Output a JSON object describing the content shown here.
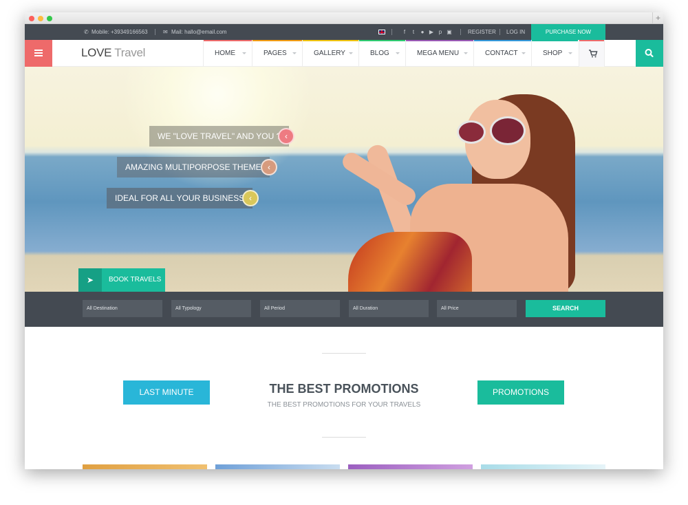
{
  "topbar": {
    "mobile": "Mobile: +39349166563",
    "mail": "Mail: hallo@email.com",
    "social_icons": [
      "facebook-icon",
      "twitter-icon",
      "flickr-icon",
      "youtube-icon",
      "pinterest-icon",
      "instagram-icon"
    ],
    "register": "REGISTER",
    "login": "LOG IN",
    "purchase": "PURCHASE NOW"
  },
  "header": {
    "logo_bold": "LOVE",
    "logo_light": "Travel",
    "nav": [
      {
        "label": "HOME",
        "color": "#ee6a6a"
      },
      {
        "label": "PAGES",
        "color": "#f39c12"
      },
      {
        "label": "GALLERY",
        "color": "#f1c40f"
      },
      {
        "label": "BLOG",
        "color": "#2ecc71"
      },
      {
        "label": "MEGA MENU",
        "color": "#9b59b6"
      },
      {
        "label": "CONTACT",
        "color": "#3498db"
      },
      {
        "label": "SHOP",
        "color": "#1abc9c"
      }
    ],
    "accent_red": "#ee6a6a",
    "accent_teal": "#1abc9c"
  },
  "hero": {
    "slides": [
      {
        "label": "WE \"LOVE TRAVEL\" AND YOU ?",
        "dot_color": "#ee7b82"
      },
      {
        "label": "AMAZING MULTIPORPOSE THEME",
        "dot_color": "#d79b7e"
      },
      {
        "label": "IDEAL FOR ALL YOUR BUSINESS",
        "dot_color": "#d9c75a"
      }
    ],
    "book_label": "BOOK TRAVELS"
  },
  "filters": {
    "destination": "All Destination",
    "typology": "All Typology",
    "period": "All Period",
    "duration": "All Duration",
    "price": "All Price",
    "search": "SEARCH"
  },
  "promotions": {
    "last_minute": "LAST MINUTE",
    "title": "THE BEST PROMOTIONS",
    "subtitle": "THE BEST PROMOTIONS FOR YOUR TRAVELS",
    "promotions_btn": "PROMOTIONS",
    "last_minute_color": "#29b6d8",
    "promotions_color": "#1abc9c"
  }
}
